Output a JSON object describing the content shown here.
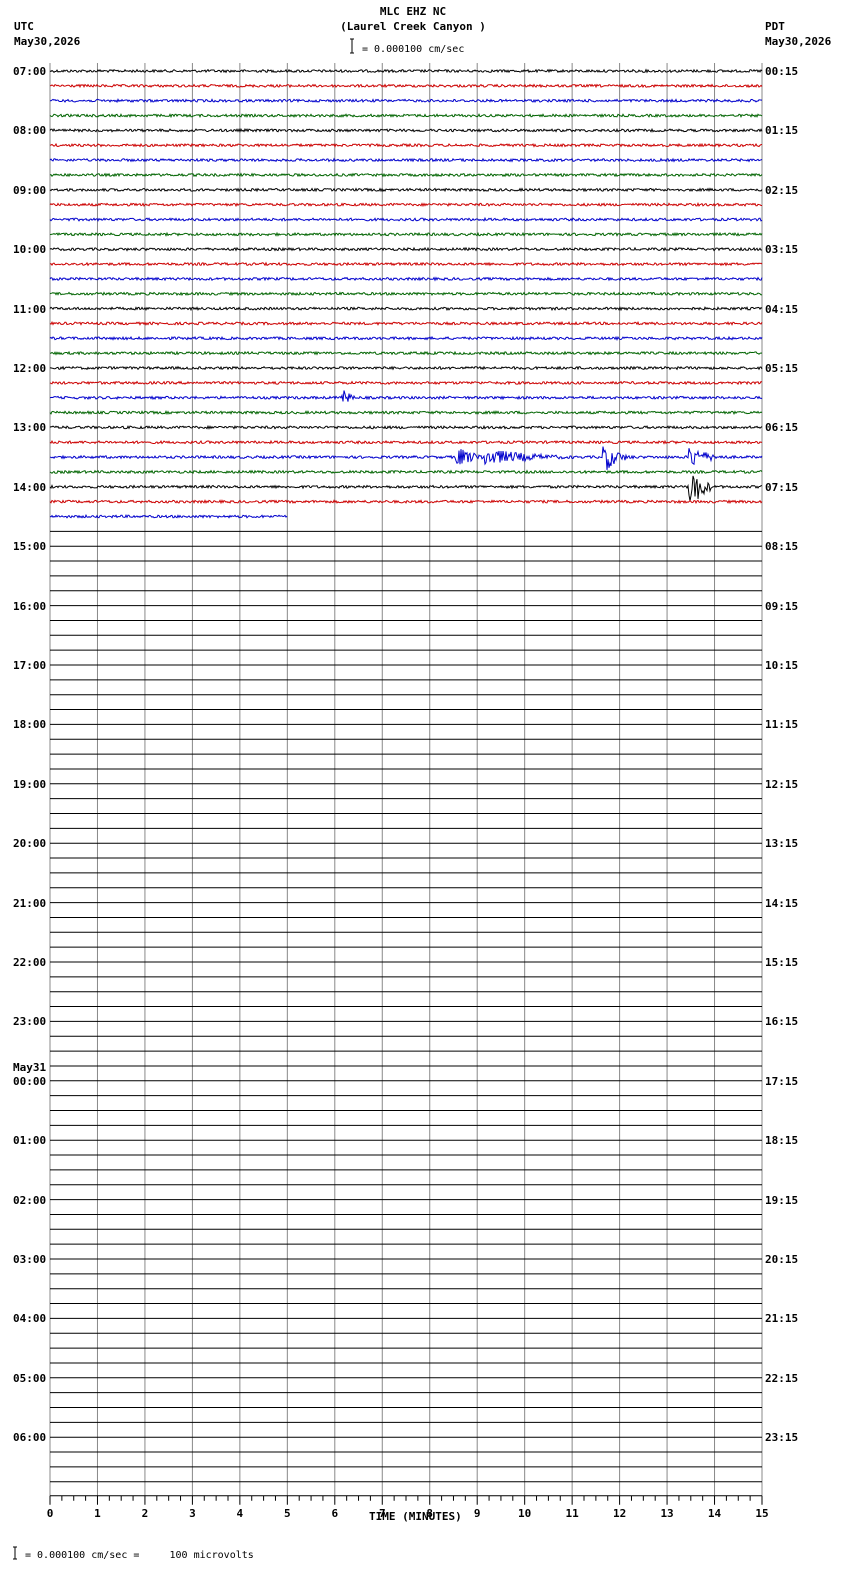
{
  "header": {
    "station": "MLC EHZ NC",
    "location": "(Laurel Creek Canyon )",
    "scale": "= 0.000100 cm/sec",
    "left_tz": "UTC",
    "left_date": "May30,2026",
    "right_tz": "PDT",
    "right_date": "May30,2026"
  },
  "footer": {
    "scale_note": "= 0.000100 cm/sec =     100 microvolts"
  },
  "chart_data": {
    "type": "line",
    "title": "MLC EHZ NC",
    "subtitle": "(Laurel Creek Canyon )",
    "xlabel": "TIME (MINUTES)",
    "xlim": [
      0,
      15
    ],
    "x_ticks": [
      "0",
      "1",
      "2",
      "3",
      "4",
      "5",
      "6",
      "7",
      "8",
      "9",
      "10",
      "11",
      "12",
      "13",
      "14",
      "15"
    ],
    "left_labels": [
      "07:00",
      "08:00",
      "09:00",
      "10:00",
      "11:00",
      "12:00",
      "13:00",
      "14:00",
      "15:00",
      "16:00",
      "17:00",
      "18:00",
      "19:00",
      "20:00",
      "21:00",
      "22:00",
      "23:00",
      "00:00",
      "01:00",
      "02:00",
      "03:00",
      "04:00",
      "05:00",
      "06:00"
    ],
    "date_change_label": "May31",
    "right_labels": [
      "00:15",
      "01:15",
      "02:15",
      "03:15",
      "04:15",
      "05:15",
      "06:15",
      "07:15",
      "08:15",
      "09:15",
      "10:15",
      "11:15",
      "12:15",
      "13:15",
      "14:15",
      "15:15",
      "16:15",
      "17:15",
      "18:15",
      "19:15",
      "20:15",
      "21:15",
      "22:15",
      "23:15"
    ],
    "trace_colors": [
      "#000000",
      "#cc0000",
      "#0000cc",
      "#006400"
    ],
    "rows_total": 96,
    "rows_with_data": 31,
    "last_row_end_minute": 5,
    "events": [
      {
        "row": 22,
        "minute": 6.2,
        "amplitude": 0.6,
        "duration_min": 0.3
      },
      {
        "row": 26,
        "minute": 8.6,
        "amplitude": 0.7,
        "duration_min": 0.8
      },
      {
        "row": 26,
        "minute": 9.2,
        "amplitude": 0.6,
        "duration_min": 2.2
      },
      {
        "row": 26,
        "minute": 11.7,
        "amplitude": 1.0,
        "duration_min": 0.6
      },
      {
        "row": 26,
        "minute": 13.5,
        "amplitude": 0.8,
        "duration_min": 0.8
      },
      {
        "row": 28,
        "minute": 13.5,
        "amplitude": 1.7,
        "duration_min": 0.5
      }
    ]
  }
}
